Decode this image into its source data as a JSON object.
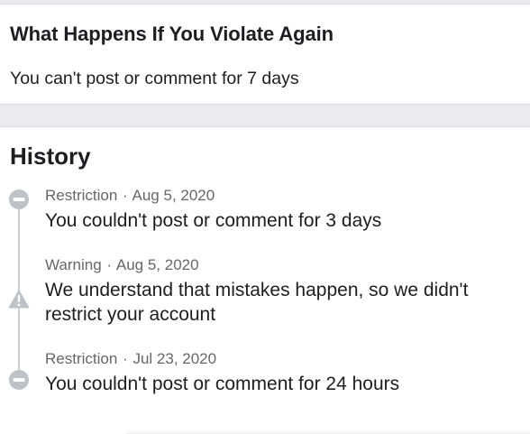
{
  "violation": {
    "title": "What Happens If You Violate Again",
    "body": "You can't post or comment for 7 days"
  },
  "history": {
    "title": "History",
    "separator": "·",
    "entries": [
      {
        "type": "Restriction",
        "date": "Aug 5, 2020",
        "description": "You couldn't post or comment for 3 days",
        "icon": "restriction-icon"
      },
      {
        "type": "Warning",
        "date": "Aug 5, 2020",
        "description": "We understand that mistakes happen, so we didn't restrict your account",
        "icon": "warning-icon"
      },
      {
        "type": "Restriction",
        "date": "Jul 23, 2020",
        "description": "You couldn't post or comment for 24 hours",
        "icon": "restriction-icon"
      }
    ]
  },
  "colors": {
    "icon": "#bec3c9",
    "meta_text": "#65676b",
    "primary_text": "#1c1e21",
    "background": "#e9ebee"
  }
}
